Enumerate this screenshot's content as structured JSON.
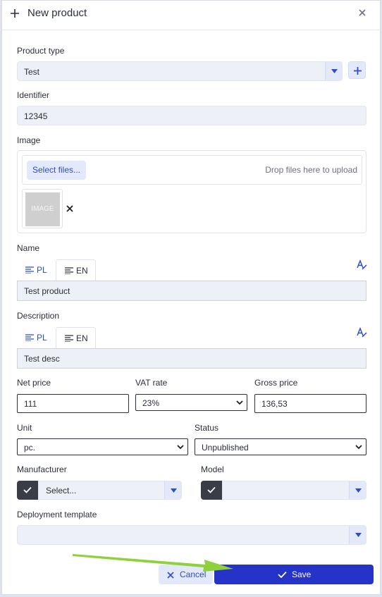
{
  "header": {
    "title": "New product"
  },
  "product_type": {
    "label": "Product type",
    "value": "Test"
  },
  "identifier": {
    "label": "Identifier",
    "value": "12345"
  },
  "image": {
    "label": "Image",
    "select_files": "Select files...",
    "drop_text": "Drop files here to upload",
    "thumb_text": "IMAGE"
  },
  "name": {
    "label": "Name",
    "tabs": [
      "PL",
      "EN"
    ],
    "value": "Test product"
  },
  "description": {
    "label": "Description",
    "tabs": [
      "PL",
      "EN"
    ],
    "value": "Test desc"
  },
  "pricing": {
    "net_label": "Net price",
    "net_value": "111",
    "vat_label": "VAT rate",
    "vat_value": "23%",
    "gross_label": "Gross price",
    "gross_value": "136,53"
  },
  "unit": {
    "label": "Unit",
    "value": "pc."
  },
  "status": {
    "label": "Status",
    "value": "Unpublished"
  },
  "manufacturer": {
    "label": "Manufacturer",
    "placeholder": "Select..."
  },
  "model": {
    "label": "Model",
    "value": ""
  },
  "deployment": {
    "label": "Deployment template",
    "value": ""
  },
  "footer": {
    "cancel_label": "Cancel",
    "save_label": "Save"
  },
  "colors": {
    "accent": "#2533c9",
    "link": "#2c4ec6",
    "soft_accent": "#e3e8fb",
    "field_bg": "#eef0f7",
    "arrow": "#8fd13b"
  },
  "icons": [
    "plus-icon",
    "close-icon",
    "chevron-down-icon",
    "text-align-icon",
    "translate-icon",
    "check-icon"
  ]
}
